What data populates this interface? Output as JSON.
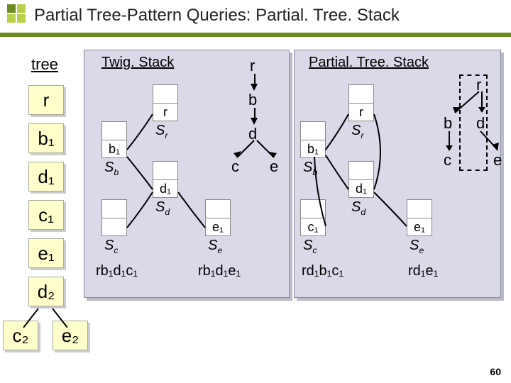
{
  "title": "Partial Tree-Pattern Queries: Partial. Tree. Stack",
  "page_number": "60",
  "tree_header": "tree",
  "tree_nodes": [
    "r",
    "b₁",
    "d₁",
    "c₁",
    "e₁",
    "d₂",
    "c₂",
    "e₂"
  ],
  "panels": {
    "twig": {
      "title": "Twig. Stack",
      "stacks": {
        "Sr": {
          "name": "Sᵣ",
          "cells": [
            "r"
          ]
        },
        "Sb": {
          "name": "S_b",
          "cells": [
            "b₁"
          ]
        },
        "Sd": {
          "name": "S_d",
          "cells": [
            "d₁"
          ]
        },
        "Sc": {
          "name": "S_c",
          "cells": [
            ""
          ]
        },
        "Se": {
          "name": "S_e",
          "cells": [
            "e₁"
          ]
        }
      },
      "paths": [
        "rb₁d₁c₁",
        "rb₁d₁e₁"
      ]
    },
    "pts": {
      "title": "Partial. Tree. Stack",
      "stacks": {
        "Sr": {
          "name": "Sᵣ",
          "cells": [
            "r"
          ]
        },
        "Sb": {
          "name": "S_b",
          "cells": [
            "b₁"
          ]
        },
        "Sd": {
          "name": "S_d",
          "cells": [
            "d₁"
          ]
        },
        "Sc": {
          "name": "S_c",
          "cells": [
            "c₁"
          ]
        },
        "Se": {
          "name": "S_e",
          "cells": [
            "e₁"
          ]
        }
      },
      "paths": [
        "rd₁b₁c₁",
        "rd₁e₁"
      ]
    }
  },
  "query_tree": {
    "nodes": [
      "r",
      "b",
      "d",
      "c",
      "e"
    ]
  }
}
